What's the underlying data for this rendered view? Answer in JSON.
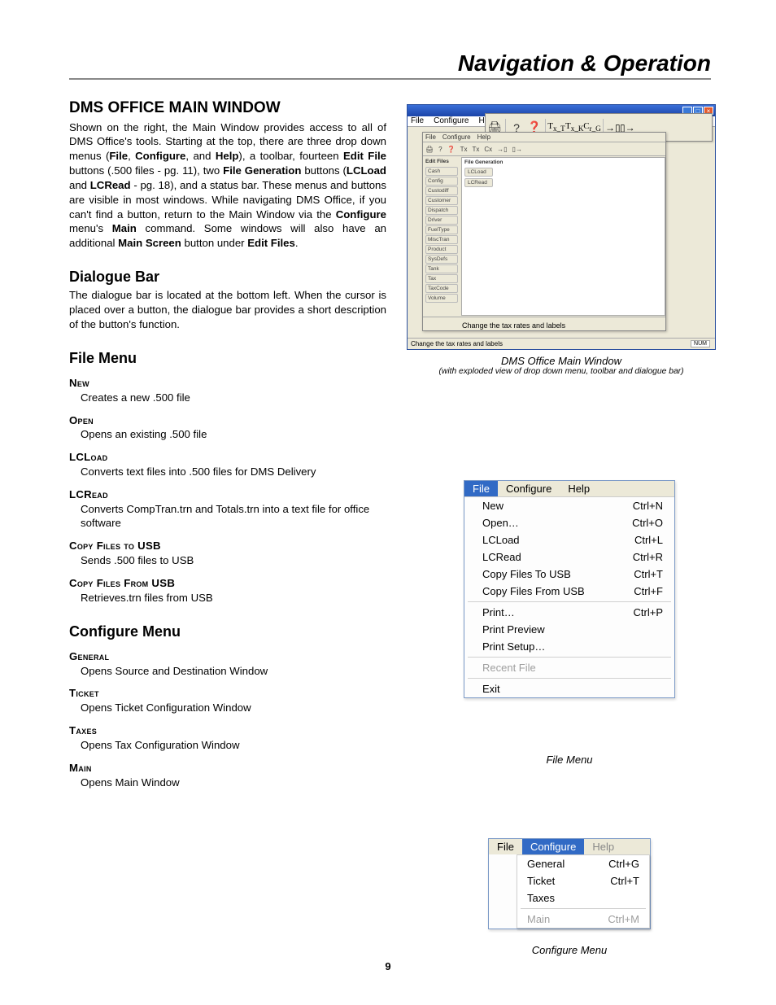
{
  "page": {
    "title": "Navigation & Operation",
    "number": "9"
  },
  "sections": {
    "mainWindow": {
      "heading": "DMS OFFICE MAIN WINDOW",
      "para_pre": "Shown on the right, the Main Window provides access to all of DMS Office's tools. Starting at the top, there are three drop down menus (",
      "b1": "File",
      "c1": ", ",
      "b2": "Configure",
      "c2": ", and ",
      "b3": "Help",
      "c3": "), a toolbar, fourteen ",
      "b4": "Edit File",
      "c4": " buttons (.500 files - pg. 11), two ",
      "b5": "File Generation",
      "c5": " buttons (",
      "b6": "LCLoad",
      "c6": " and ",
      "b7": "LCRead",
      "c7": " - pg. 18), and a status bar. These menus and buttons are visible in most windows. While navigating DMS Office, if you can't find a button, return to the Main Window via the ",
      "b8": "Configure",
      "c8": " menu's ",
      "b9": "Main",
      "c9": " command. Some windows will also have an additional ",
      "b10": "Main Screen",
      "c10": " button under ",
      "b11": "Edit Files",
      "c11": "."
    },
    "dialogue": {
      "heading": "Dialogue Bar",
      "text": "The dialogue bar is located at the bottom left. When the cursor is placed over a button, the dialogue bar provides a short description of the button's function."
    },
    "fileMenu": {
      "heading": "File Menu",
      "items": [
        {
          "name": "New",
          "desc": "Creates a new .500 file"
        },
        {
          "name": "Open",
          "desc": "Opens an existing .500 file"
        },
        {
          "name": "LCLoad",
          "desc": "Converts text files into .500 files for DMS Delivery"
        },
        {
          "name": "LCRead",
          "desc": "Converts CompTran.trn and Totals.trn into a text file for office software"
        },
        {
          "name": "Copy Files to USB",
          "desc": "Sends .500 files to USB"
        },
        {
          "name": "Copy Files From USB",
          "desc": "Retrieves.trn files from USB"
        }
      ]
    },
    "configMenu": {
      "heading": "Configure Menu",
      "items": [
        {
          "name": "General",
          "desc": "Opens Source and Destination Window"
        },
        {
          "name": "Ticket",
          "desc": "Opens Ticket Configuration Window"
        },
        {
          "name": "Taxes",
          "desc": "Opens Tax Configuration Window"
        },
        {
          "name": "Main",
          "desc": "Opens Main Window"
        }
      ]
    }
  },
  "mainWindowFig": {
    "menubar": [
      "File",
      "Configure",
      "Help"
    ],
    "toolbarBig": {
      "icons": [
        "🖨",
        "?",
        "❓"
      ],
      "letters": [
        "Tx_T",
        "Tx_K",
        "Cr_G"
      ],
      "arrows": [
        "→▯",
        "▯→"
      ]
    },
    "innerMenu": [
      "File",
      "Configure",
      "Help"
    ],
    "innerTool": [
      "🖨",
      "?",
      "❓",
      "Tx",
      "Tx",
      "Cx",
      "→▯",
      "▯→"
    ],
    "doorHeader": "Edit Files",
    "doorButtons": [
      "Cash",
      "Config",
      "Custodiff",
      "Customer",
      "Dispatch",
      "Driver",
      "FuelType",
      "MiscTran",
      "Product",
      "SysDefs",
      "Tank",
      "Tax",
      "TaxCode",
      "Volume"
    ],
    "mainHeader": "File Generation",
    "mainButtons": [
      "LCLoad",
      "LCRead"
    ],
    "innerStatus": "Change the tax rates and labels",
    "outerStatus": "Change the tax rates and labels",
    "statusNum": "NUM",
    "caption": "DMS Office Main Window",
    "captionSub": "(with exploded view of drop down menu, toolbar and dialogue bar)"
  },
  "fileMenuFig": {
    "menubar": [
      "File",
      "Configure",
      "Help"
    ],
    "rows": [
      {
        "l": "New",
        "r": "Ctrl+N"
      },
      {
        "l": "Open…",
        "r": "Ctrl+O"
      },
      {
        "l": "LCLoad",
        "r": "Ctrl+L"
      },
      {
        "l": "LCRead",
        "r": "Ctrl+R"
      },
      {
        "l": "Copy Files To USB",
        "r": "Ctrl+T"
      },
      {
        "l": "Copy Files From USB",
        "r": "Ctrl+F"
      }
    ],
    "rows2": [
      {
        "l": "Print…",
        "r": "Ctrl+P"
      },
      {
        "l": "Print Preview",
        "r": ""
      },
      {
        "l": "Print Setup…",
        "r": ""
      }
    ],
    "recent": "Recent File",
    "exit": "Exit",
    "caption": "File Menu"
  },
  "configMenuFig": {
    "menubar": [
      "File",
      "Configure",
      "Help"
    ],
    "rows": [
      {
        "l": "General",
        "r": "Ctrl+G"
      },
      {
        "l": "Ticket",
        "r": "Ctrl+T"
      },
      {
        "l": "Taxes",
        "r": ""
      }
    ],
    "rows2": [
      {
        "l": "Main",
        "r": "Ctrl+M",
        "disabled": true
      }
    ],
    "caption": "Configure Menu"
  }
}
